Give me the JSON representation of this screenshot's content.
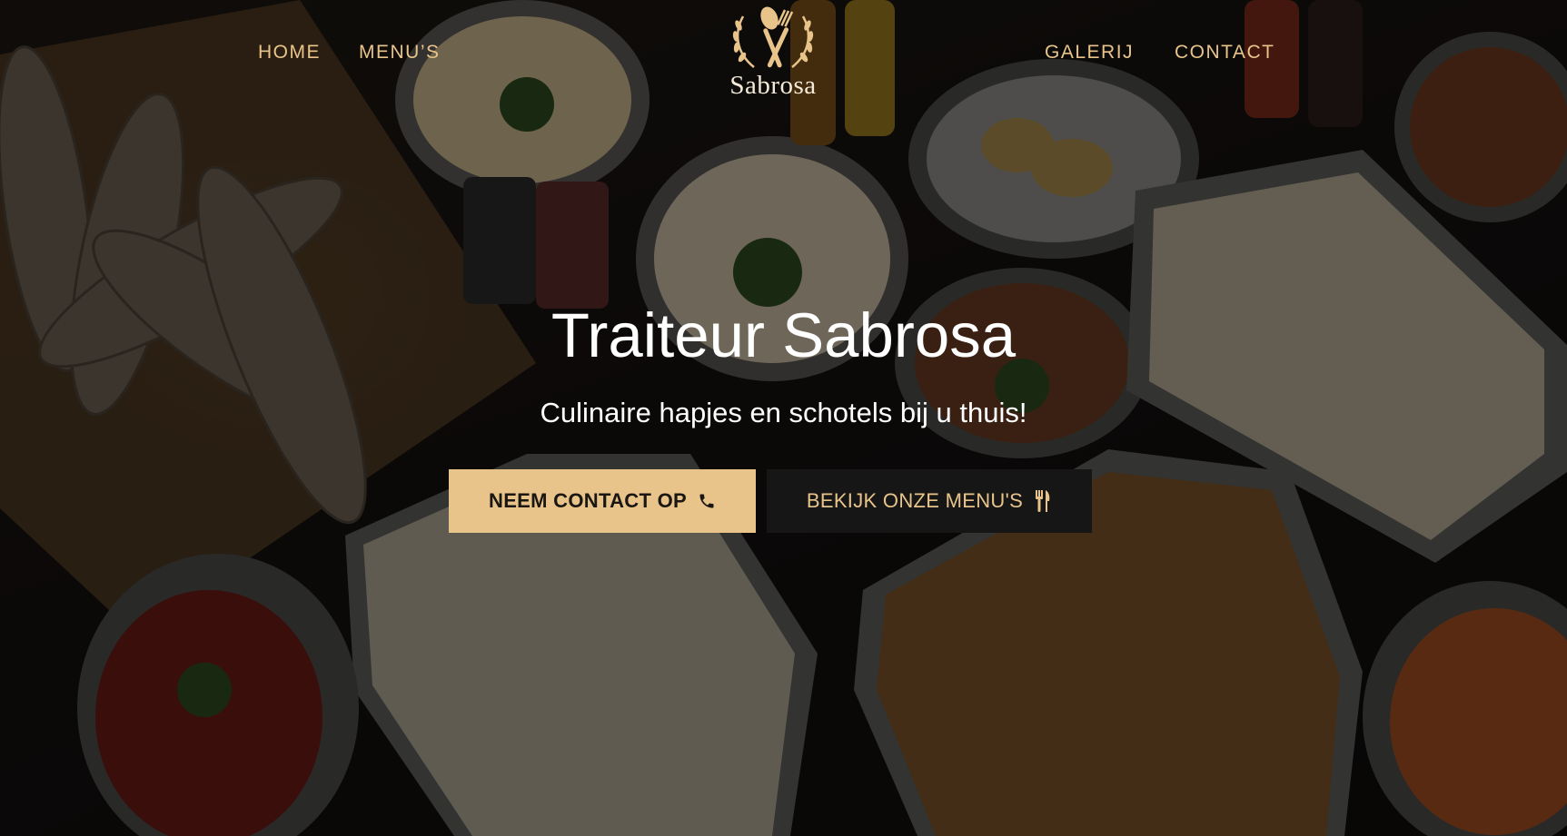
{
  "nav": {
    "left": [
      {
        "label": "HOME"
      },
      {
        "label": "MENU’S"
      }
    ],
    "right": [
      {
        "label": "GALERIJ"
      },
      {
        "label": "CONTACT"
      }
    ]
  },
  "logo": {
    "text": "Sabrosa",
    "icon": "laurel-fork-spoon-icon"
  },
  "hero": {
    "title": "Traiteur Sabrosa",
    "subtitle": "Culinaire hapjes en schotels bij u thuis!",
    "buttons": [
      {
        "label": "NEEM CONTACT OP",
        "icon": "phone-icon"
      },
      {
        "label": "BEKIJK ONZE MENU'S",
        "icon": "utensils-icon"
      }
    ]
  },
  "colors": {
    "accent": "#e8c48a",
    "dark_button": "#161616",
    "text": "#ffffff"
  }
}
